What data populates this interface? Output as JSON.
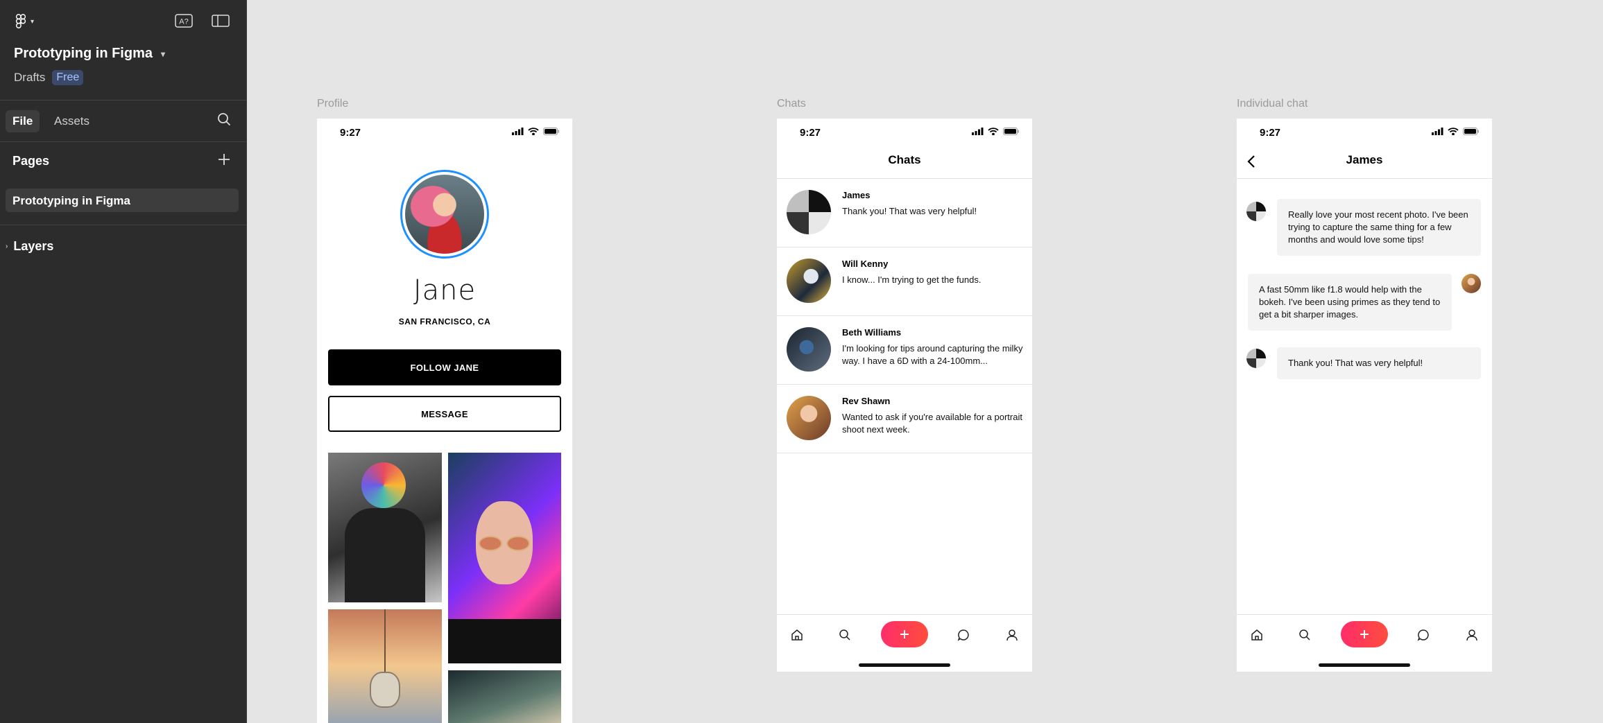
{
  "sidebar": {
    "file_title": "Prototyping in Figma",
    "location": "Drafts",
    "plan_badge": "Free",
    "tabs": [
      {
        "label": "File"
      },
      {
        "label": "Assets"
      }
    ],
    "pages_heading": "Pages",
    "pages": [
      {
        "label": "Prototyping in Figma"
      }
    ],
    "layers_heading": "Layers",
    "icons": {
      "logo": "figma-logo-icon",
      "text_tool": "a-question-icon",
      "panel": "sidebar-toggle-icon",
      "search": "search-icon",
      "add": "plus-icon",
      "expand": "chevron-right-icon"
    }
  },
  "frames": {
    "profile": {
      "label": "Profile",
      "time": "9:27",
      "name": "Jane",
      "location": "SAN FRANCISCO, CA",
      "follow_label": "FOLLOW JANE",
      "message_label": "MESSAGE"
    },
    "chats": {
      "label": "Chats",
      "time": "9:27",
      "title": "Chats",
      "items": [
        {
          "name": "James",
          "message": "Thank you! That was very helpful!"
        },
        {
          "name": "Will Kenny",
          "message": "I know... I'm trying to get the funds."
        },
        {
          "name": "Beth Williams",
          "message": "I'm looking for tips around capturing the milky way. I have a 6D with a 24-100mm..."
        },
        {
          "name": "Rev Shawn",
          "message": "Wanted to ask if you're available for a portrait shoot next week."
        }
      ]
    },
    "individual": {
      "label": "Individual chat",
      "time": "9:27",
      "title": "James",
      "messages": [
        {
          "text": "Really love your most recent photo. I've been trying to capture the same thing for a few months and would love some tips!"
        },
        {
          "text": "A fast 50mm like f1.8 would help with the bokeh. I've been using primes as they tend to get a bit sharper images."
        },
        {
          "text": "Thank you! That was very helpful!"
        }
      ]
    }
  },
  "colors": {
    "accent_gradient_start": "#ff2d6a",
    "accent_gradient_end": "#ff4d3d",
    "avatar_ring": "#1e90ff",
    "sidebar_bg": "#2c2c2c",
    "canvas_bg": "#e5e5e5"
  }
}
